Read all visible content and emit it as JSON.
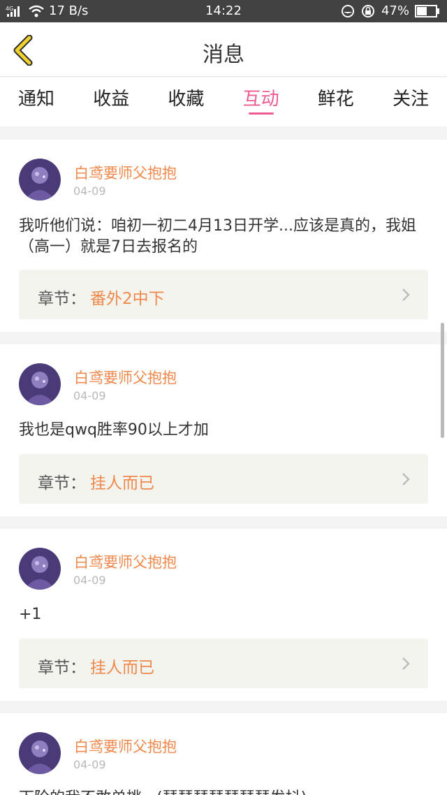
{
  "status_bar": {
    "network": "4G",
    "speed": "17 B/s",
    "time": "14:22",
    "battery": "47%",
    "icons": [
      "signal-icon",
      "wifi-icon",
      "data-saver-icon",
      "lock-rotation-icon",
      "battery-icon"
    ]
  },
  "header": {
    "title": "消息",
    "back_icon": "chevron-left-icon"
  },
  "tabs": [
    {
      "label": "通知",
      "active": false
    },
    {
      "label": "收益",
      "active": false
    },
    {
      "label": "收藏",
      "active": false
    },
    {
      "label": "互动",
      "active": true
    },
    {
      "label": "鲜花",
      "active": false
    },
    {
      "label": "关注",
      "active": false
    }
  ],
  "messages": [
    {
      "user": "白鸢要师父抱抱",
      "date": "04-09",
      "content": "我听他们说：咱初一初二4月13日开学...应该是真的，我姐（高一）就是7日去报名的",
      "chapter_label": "章节：",
      "chapter_title": "番外2中下"
    },
    {
      "user": "白鸢要师父抱抱",
      "date": "04-09",
      "content": "我也是qwq胜率90以上才加",
      "chapter_label": "章节：",
      "chapter_title": "挂人而已"
    },
    {
      "user": "白鸢要师父抱抱",
      "date": "04-09",
      "content": "+1",
      "chapter_label": "章节：",
      "chapter_title": "挂人而已"
    },
    {
      "user": "白鸢要师父抱抱",
      "date": "04-09",
      "content": "下阶的我不敢单挑...(瑟瑟瑟瑟瑟瑟瑟发抖)"
    }
  ],
  "colors": {
    "accent_pink": "#ee5b93",
    "name_orange": "#f0884b",
    "back_yellow": "#f2d232"
  }
}
